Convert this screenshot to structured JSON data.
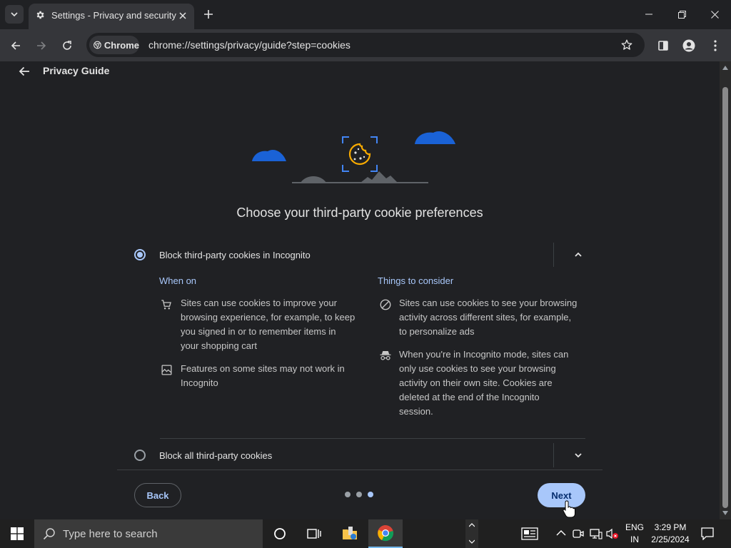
{
  "browser": {
    "tab": {
      "title": "Settings - Privacy and security"
    },
    "omnibox": {
      "site_chip": "Chrome",
      "url": "chrome://settings/privacy/guide?step=cookies"
    }
  },
  "page": {
    "title": "Privacy Guide",
    "heading": "Choose your third-party cookie preferences",
    "options": [
      {
        "label": "Block third-party cookies in Incognito",
        "selected": true,
        "expanded": true,
        "when_on": {
          "title": "When on",
          "items": [
            {
              "icon": "cart-icon",
              "text_lines": [
                "Sites can use cookies to improve your",
                "browsing experience, for example, to keep",
                "you signed in or to remember items in",
                "your shopping cart"
              ]
            },
            {
              "icon": "broken-image-icon",
              "text_lines": [
                "Features on some sites may not work in",
                "Incognito"
              ]
            }
          ]
        },
        "consider": {
          "title": "Things to consider",
          "items": [
            {
              "icon": "block-icon",
              "text_lines": [
                "Sites can use cookies to see your browsing",
                "activity across different sites, for example,",
                "to personalize ads"
              ]
            },
            {
              "icon": "incognito-icon",
              "text_lines": [
                "When you're in Incognito mode, sites can",
                "only use cookies to see your browsing",
                "activity on their own site. Cookies are",
                "deleted at the end of the Incognito",
                "session."
              ]
            }
          ]
        }
      },
      {
        "label": "Block all third-party cookies",
        "selected": false,
        "expanded": false
      }
    ],
    "buttons": {
      "back": "Back",
      "next": "Next"
    },
    "steps": {
      "total": 3,
      "current": 3
    }
  },
  "taskbar": {
    "search_placeholder": "Type here to search",
    "lang_line1": "ENG",
    "lang_line2": "IN",
    "time": "3:29 PM",
    "date": "2/25/2024"
  },
  "colors": {
    "accent": "#a8c7fa",
    "cloud": "#1a62d6",
    "cookie": "#f9ab00"
  }
}
